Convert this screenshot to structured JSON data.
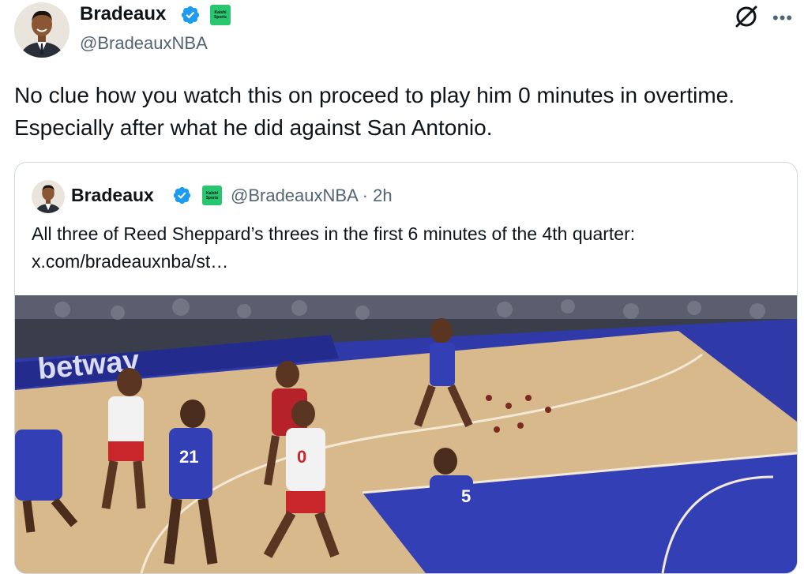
{
  "tweet": {
    "author_name": "Bradeaux",
    "author_handle": "@BradeauxNBA",
    "text": "No clue how you watch this on proceed to play him 0 minutes in overtime. Especially after what he did against San Antonio.",
    "sponsor_badge_line1": "Kalshi",
    "sponsor_badge_line2": "Sports"
  },
  "quote": {
    "author_name": "Bradeaux",
    "author_handle_time": "@BradeauxNBA · 2h",
    "text": "All three of Reed Sheppard’s threes in the first 6 minutes of the 4th quarter: x.com/bradeauxnba/st…",
    "sponsor_badge_line1": "Kalshi",
    "sponsor_badge_line2": "Sports"
  },
  "media": {
    "court_ad_text": "betway",
    "jersey_numbers": [
      "21",
      "5",
      "0"
    ]
  },
  "icons": {
    "verified": "verified-badge-icon",
    "grok": "grok-icon",
    "more": "more-icon"
  },
  "colors": {
    "verified_blue": "#1d9bf0",
    "kalshi_green": "#28c76f",
    "secondary_text": "#536471"
  }
}
